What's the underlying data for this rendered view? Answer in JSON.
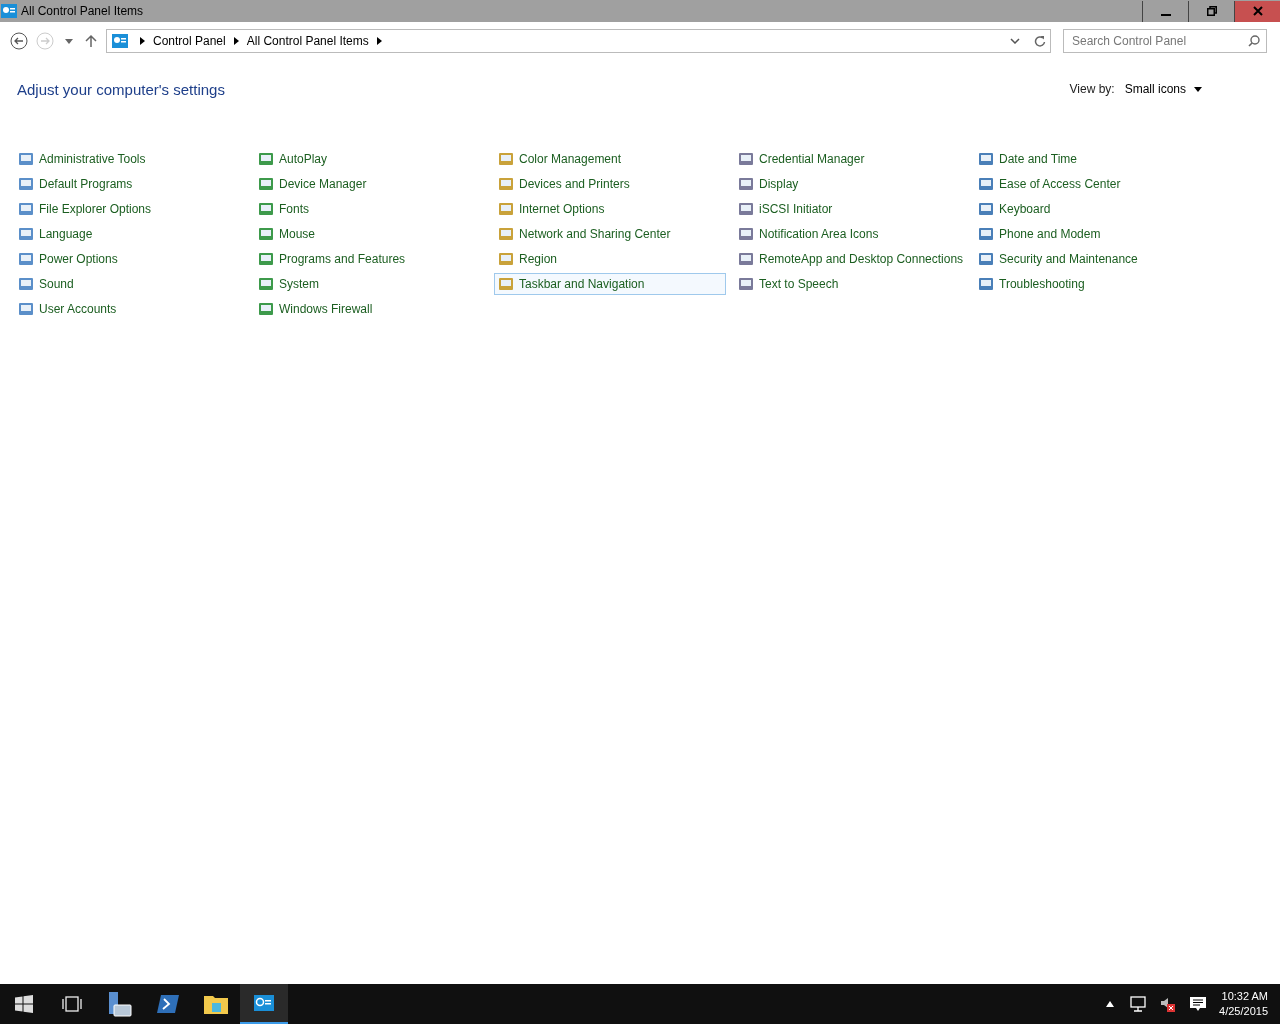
{
  "window": {
    "title": "All Control Panel Items"
  },
  "address_bar": {
    "breadcrumbs": [
      "Control Panel",
      "All Control Panel Items"
    ]
  },
  "search": {
    "placeholder": "Search Control Panel"
  },
  "heading": "Adjust your computer's settings",
  "view_by": {
    "label": "View by:",
    "value": "Small icons"
  },
  "items": [
    {
      "label": "Administrative Tools",
      "highlighted": false
    },
    {
      "label": "AutoPlay",
      "highlighted": false
    },
    {
      "label": "Color Management",
      "highlighted": false
    },
    {
      "label": "Credential Manager",
      "highlighted": false
    },
    {
      "label": "Date and Time",
      "highlighted": false
    },
    {
      "label": "Default Programs",
      "highlighted": false
    },
    {
      "label": "Device Manager",
      "highlighted": false
    },
    {
      "label": "Devices and Printers",
      "highlighted": false
    },
    {
      "label": "Display",
      "highlighted": false
    },
    {
      "label": "Ease of Access Center",
      "highlighted": false
    },
    {
      "label": "File Explorer Options",
      "highlighted": false
    },
    {
      "label": "Fonts",
      "highlighted": false
    },
    {
      "label": "Internet Options",
      "highlighted": false
    },
    {
      "label": "iSCSI Initiator",
      "highlighted": false
    },
    {
      "label": "Keyboard",
      "highlighted": false
    },
    {
      "label": "Language",
      "highlighted": false
    },
    {
      "label": "Mouse",
      "highlighted": false
    },
    {
      "label": "Network and Sharing Center",
      "highlighted": false
    },
    {
      "label": "Notification Area Icons",
      "highlighted": false
    },
    {
      "label": "Phone and Modem",
      "highlighted": false
    },
    {
      "label": "Power Options",
      "highlighted": false
    },
    {
      "label": "Programs and Features",
      "highlighted": false
    },
    {
      "label": "Region",
      "highlighted": false
    },
    {
      "label": "RemoteApp and Desktop Connections",
      "highlighted": false
    },
    {
      "label": "Security and Maintenance",
      "highlighted": false
    },
    {
      "label": "Sound",
      "highlighted": false
    },
    {
      "label": "System",
      "highlighted": false
    },
    {
      "label": "Taskbar and Navigation",
      "highlighted": true
    },
    {
      "label": "Text to Speech",
      "highlighted": false
    },
    {
      "label": "Troubleshooting",
      "highlighted": false
    },
    {
      "label": "User Accounts",
      "highlighted": false
    },
    {
      "label": "Windows Firewall",
      "highlighted": false
    }
  ],
  "taskbar": {
    "time": "10:32 AM",
    "date": "4/25/2015"
  }
}
